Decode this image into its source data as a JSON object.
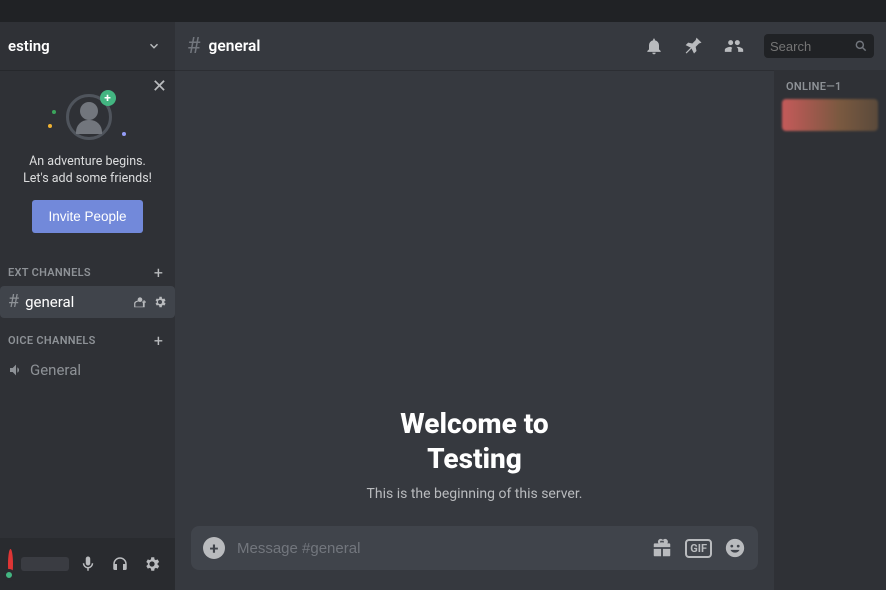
{
  "server": {
    "name": "esting"
  },
  "invite": {
    "line1": "An adventure begins.",
    "line2": "Let's add some friends!",
    "button": "Invite People"
  },
  "sections": {
    "text_label": "EXT CHANNELS",
    "voice_label": "OICE CHANNELS"
  },
  "channels": {
    "text": {
      "general": "general"
    },
    "voice": {
      "general": "General"
    }
  },
  "chat": {
    "title": "general",
    "welcome_title_l1": "Welcome to",
    "welcome_title_l2": "Testing",
    "welcome_sub": "This is the beginning of this server.",
    "composer_placeholder": "Message #general"
  },
  "search": {
    "placeholder": "Search"
  },
  "members": {
    "header": "ONLINE—1"
  },
  "icons": {
    "gif": "GIF"
  }
}
